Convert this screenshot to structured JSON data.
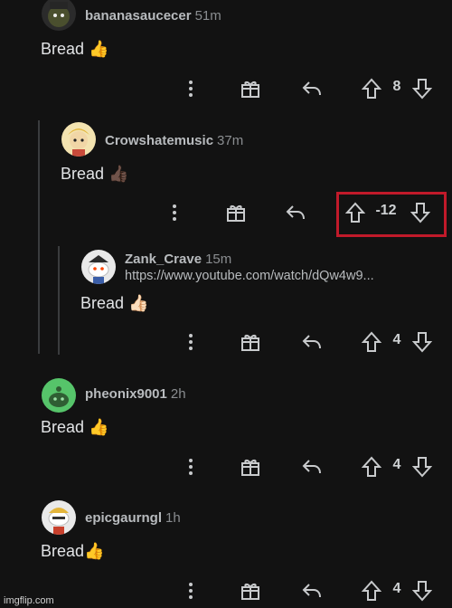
{
  "comments": [
    {
      "username": "bananasaucecer",
      "time": "51m",
      "body": "Bread",
      "thumb": "👍",
      "score": "8"
    },
    {
      "username": "Crowshatemusic",
      "time": "37m",
      "body": "Bread",
      "thumb": "👍🏿",
      "score": "-12"
    },
    {
      "username": "Zank_Crave",
      "time": "15m",
      "link": "https://www.youtube.com/watch/dQw4w9...",
      "body": "Bread",
      "thumb": "👍🏻",
      "score": "4"
    },
    {
      "username": "pheonix9001",
      "time": "2h",
      "body": "Bread",
      "thumb": "👍",
      "score": "4"
    },
    {
      "username": "epicgaurngl",
      "time": "1h",
      "body": "Bread",
      "thumb": "👍",
      "score": "4"
    }
  ],
  "icons": {
    "more": "more-vertical-icon",
    "award": "gift-icon",
    "reply": "reply-icon",
    "upvote": "upvote-arrow-icon",
    "downvote": "downvote-arrow-icon"
  },
  "colors": {
    "highlight": "#c11a2a",
    "background": "#121212"
  },
  "watermark": "imgflip.com"
}
